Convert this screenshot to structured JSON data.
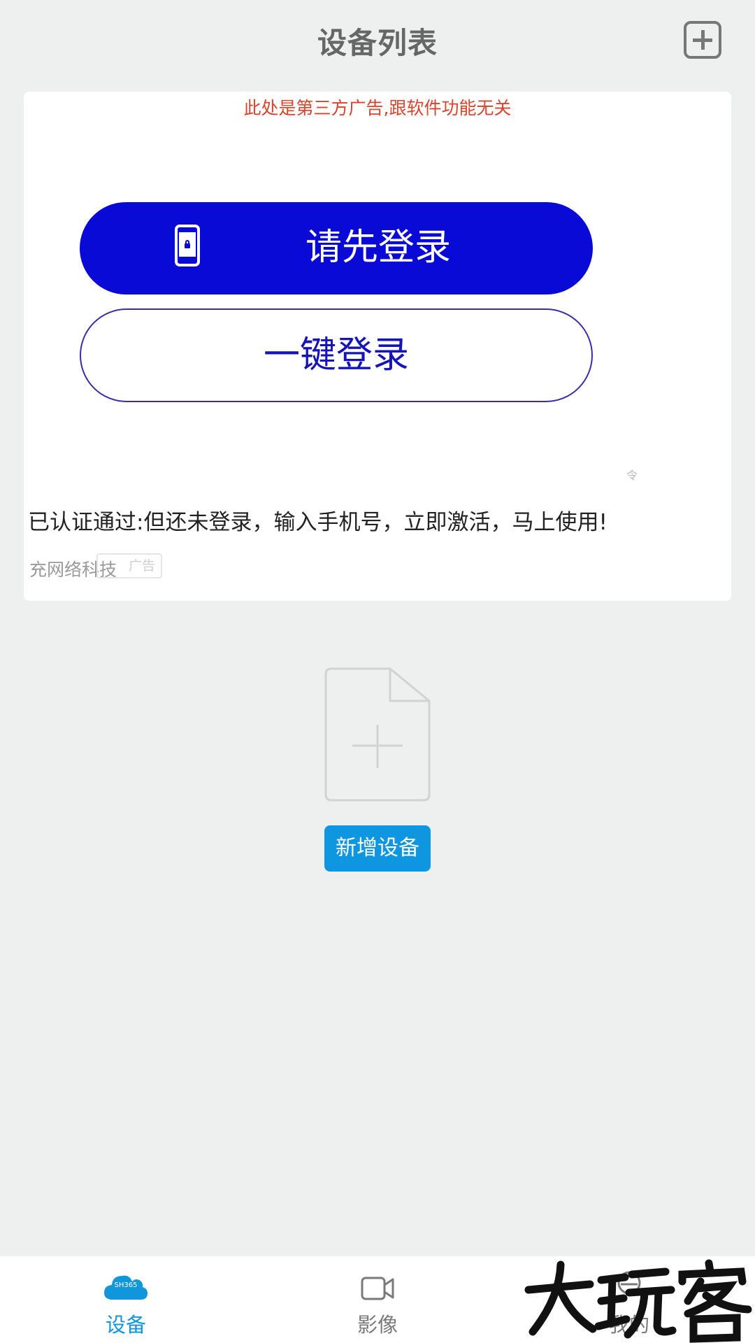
{
  "header": {
    "title": "设备列表",
    "add_icon": "plus-square-icon"
  },
  "ad": {
    "notice": "此处是第三方广告,跟软件功能无关",
    "login_primary_label": "请先登录",
    "login_primary_icon": "phone-lock-icon",
    "login_secondary_label": "一键登录",
    "small_mark": "令",
    "promo_text": "已认证通过:但还未登录，输入手机号，立即激活，马上使用!",
    "company": "充网络科技",
    "tag": "广告",
    "colors": {
      "primary_button": "#0a0ad6",
      "notice": "#d9442a"
    }
  },
  "empty_state": {
    "icon": "add-file-icon",
    "button_label": "新增设备"
  },
  "bottom_nav": {
    "items": [
      {
        "label": "设备",
        "icon": "cloud-icon",
        "icon_text": "SH365",
        "active": true
      },
      {
        "label": "影像",
        "icon": "video-camera-icon",
        "active": false
      },
      {
        "label": "我的",
        "icon": "person-icon",
        "active": false
      }
    ],
    "active_color": "#1196dc"
  },
  "watermark": {
    "text": "大玩客"
  }
}
